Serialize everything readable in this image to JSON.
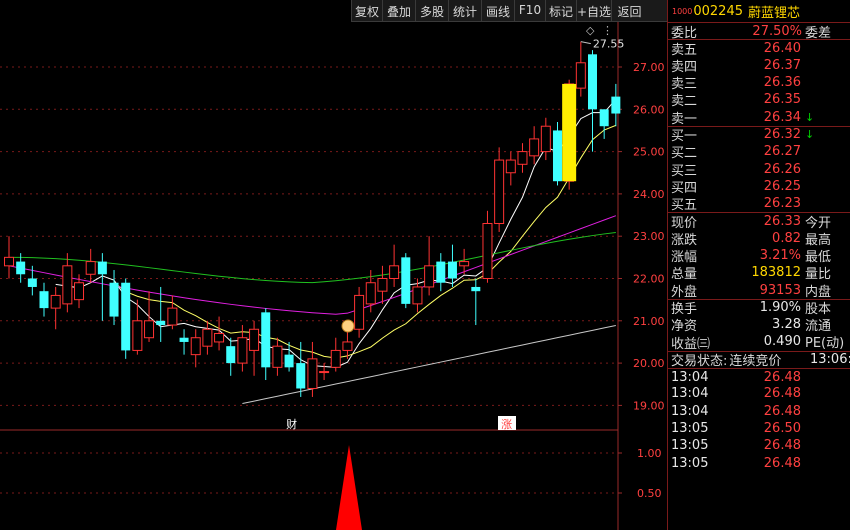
{
  "toolbar": {
    "buttons": [
      "复权",
      "叠加",
      "多股",
      "统计",
      "画线",
      "F10",
      "标记",
      "+自选",
      "返回"
    ]
  },
  "stock": {
    "prefix": "1000",
    "code": "002245",
    "name": "蔚蓝锂芯"
  },
  "quote": {
    "weibi_label": "委比",
    "weibi_value": "27.50%",
    "weicha_label": "委差",
    "sells": [
      {
        "label": "卖五",
        "price": "26.40"
      },
      {
        "label": "卖四",
        "price": "26.37"
      },
      {
        "label": "卖三",
        "price": "26.36"
      },
      {
        "label": "卖二",
        "price": "26.35"
      },
      {
        "label": "卖一",
        "price": "26.34",
        "arrow": "↓"
      }
    ],
    "buys": [
      {
        "label": "买一",
        "price": "26.32",
        "arrow": "↓"
      },
      {
        "label": "买二",
        "price": "26.27"
      },
      {
        "label": "买三",
        "price": "26.26"
      },
      {
        "label": "买四",
        "price": "26.25"
      },
      {
        "label": "买五",
        "price": "26.23"
      }
    ],
    "stats1": [
      {
        "label": "现价",
        "value": "26.33",
        "value_color": "red",
        "right": "今开"
      },
      {
        "label": "涨跌",
        "value": "0.82",
        "value_color": "red",
        "right": "最高"
      },
      {
        "label": "涨幅",
        "value": "3.21%",
        "value_color": "red",
        "right": "最低"
      },
      {
        "label": "总量",
        "value": "183812",
        "value_color": "yel",
        "right": "量比"
      },
      {
        "label": "外盘",
        "value": "93153",
        "value_color": "red",
        "right": "内盘"
      }
    ],
    "stats2": [
      {
        "label": "换手",
        "value": "1.90%",
        "value_color": "wht",
        "right": "股本"
      },
      {
        "label": "净资",
        "value": "3.28",
        "value_color": "wht",
        "right": "流通"
      },
      {
        "label": "收益㈢",
        "value": "0.490",
        "value_color": "wht",
        "right": "PE(动)"
      }
    ],
    "trade_status_label": "交易状态:",
    "trade_status": "连续竞价",
    "trade_time": "13:06:"
  },
  "ticks": [
    {
      "time": "13:04",
      "price": "26.48"
    },
    {
      "time": "13:04",
      "price": "26.48"
    },
    {
      "time": "13:04",
      "price": "26.48"
    },
    {
      "time": "13:05",
      "price": "26.50"
    },
    {
      "time": "13:05",
      "price": "26.48"
    },
    {
      "time": "13:05",
      "price": "26.48"
    }
  ],
  "chart_data": {
    "type": "candlestick",
    "price_axis": {
      "ticks": [
        "27.00",
        "26.00",
        "25.00",
        "24.00",
        "23.00",
        "22.00",
        "21.00",
        "20.00",
        "19.00"
      ],
      "range": [
        18.8,
        28.0
      ]
    },
    "max_label": "27.55",
    "markers": [
      {
        "text": "财",
        "color": "#ffffff",
        "index": 24
      },
      {
        "text": "涨",
        "color": "#ff4040",
        "index": 33
      }
    ],
    "candles": [
      {
        "o": 22.3,
        "c": 22.5,
        "h": 23.0,
        "l": 22.0
      },
      {
        "o": 22.4,
        "c": 22.1,
        "h": 22.6,
        "l": 21.9
      },
      {
        "o": 22.0,
        "c": 21.8,
        "h": 22.3,
        "l": 21.6
      },
      {
        "o": 21.7,
        "c": 21.3,
        "h": 21.9,
        "l": 21.1
      },
      {
        "o": 21.3,
        "c": 21.6,
        "h": 21.8,
        "l": 20.8
      },
      {
        "o": 21.4,
        "c": 22.3,
        "h": 22.6,
        "l": 21.2
      },
      {
        "o": 21.5,
        "c": 21.9,
        "h": 22.1,
        "l": 21.3
      },
      {
        "o": 22.1,
        "c": 22.4,
        "h": 22.7,
        "l": 21.9
      },
      {
        "o": 22.4,
        "c": 22.1,
        "h": 22.6,
        "l": 21.0
      },
      {
        "o": 21.9,
        "c": 21.1,
        "h": 22.2,
        "l": 20.9
      },
      {
        "o": 21.9,
        "c": 20.3,
        "h": 22.0,
        "l": 20.1
      },
      {
        "o": 20.3,
        "c": 21.0,
        "h": 21.5,
        "l": 20.2
      },
      {
        "o": 20.6,
        "c": 21.0,
        "h": 21.7,
        "l": 20.5
      },
      {
        "o": 21.0,
        "c": 20.9,
        "h": 21.8,
        "l": 20.5
      },
      {
        "o": 20.9,
        "c": 21.3,
        "h": 21.6,
        "l": 20.8
      },
      {
        "o": 20.6,
        "c": 20.5,
        "h": 20.8,
        "l": 20.2
      },
      {
        "o": 20.2,
        "c": 20.6,
        "h": 20.8,
        "l": 19.9
      },
      {
        "o": 20.4,
        "c": 20.8,
        "h": 21.0,
        "l": 20.2
      },
      {
        "o": 20.5,
        "c": 20.7,
        "h": 21.1,
        "l": 20.3
      },
      {
        "o": 20.4,
        "c": 20.0,
        "h": 20.6,
        "l": 19.7
      },
      {
        "o": 20.0,
        "c": 20.6,
        "h": 20.9,
        "l": 19.8
      },
      {
        "o": 20.3,
        "c": 20.8,
        "h": 21.0,
        "l": 19.7
      },
      {
        "o": 21.2,
        "c": 19.9,
        "h": 21.3,
        "l": 19.6
      },
      {
        "o": 19.9,
        "c": 20.4,
        "h": 20.6,
        "l": 19.7
      },
      {
        "o": 20.2,
        "c": 19.9,
        "h": 20.5,
        "l": 19.8
      },
      {
        "o": 20.0,
        "c": 19.4,
        "h": 20.5,
        "l": 19.2
      },
      {
        "o": 19.4,
        "c": 20.1,
        "h": 20.5,
        "l": 19.2
      },
      {
        "o": 19.8,
        "c": 19.8,
        "h": 20.0,
        "l": 19.6
      },
      {
        "o": 19.9,
        "c": 20.3,
        "h": 20.6,
        "l": 19.8
      },
      {
        "o": 20.3,
        "c": 20.5,
        "h": 20.8,
        "l": 20.1
      },
      {
        "o": 20.8,
        "c": 21.6,
        "h": 21.8,
        "l": 20.6
      },
      {
        "o": 21.4,
        "c": 21.9,
        "h": 22.2,
        "l": 21.2
      },
      {
        "o": 21.7,
        "c": 22.0,
        "h": 22.3,
        "l": 21.4
      },
      {
        "o": 22.0,
        "c": 22.3,
        "h": 22.8,
        "l": 21.8
      },
      {
        "o": 22.5,
        "c": 21.4,
        "h": 22.6,
        "l": 21.3
      },
      {
        "o": 21.4,
        "c": 21.8,
        "h": 22.0,
        "l": 21.2
      },
      {
        "o": 21.8,
        "c": 22.3,
        "h": 23.0,
        "l": 21.6
      },
      {
        "o": 22.4,
        "c": 21.9,
        "h": 22.6,
        "l": 21.7
      },
      {
        "o": 22.4,
        "c": 22.0,
        "h": 22.8,
        "l": 21.8
      },
      {
        "o": 22.3,
        "c": 22.4,
        "h": 22.7,
        "l": 22.1
      },
      {
        "o": 21.8,
        "c": 21.7,
        "h": 22.0,
        "l": 20.9
      },
      {
        "o": 22.0,
        "c": 23.3,
        "h": 23.6,
        "l": 21.9
      },
      {
        "o": 23.3,
        "c": 24.8,
        "h": 25.1,
        "l": 23.1
      },
      {
        "o": 24.5,
        "c": 24.8,
        "h": 25.0,
        "l": 24.2
      },
      {
        "o": 24.7,
        "c": 25.0,
        "h": 25.2,
        "l": 24.5
      },
      {
        "o": 24.9,
        "c": 25.3,
        "h": 25.6,
        "l": 24.7
      },
      {
        "o": 25.0,
        "c": 25.6,
        "h": 25.8,
        "l": 24.8
      },
      {
        "o": 25.5,
        "c": 24.3,
        "h": 25.7,
        "l": 24.2
      },
      {
        "o": 24.3,
        "c": 26.6,
        "h": 26.7,
        "l": 24.1
      },
      {
        "o": 26.5,
        "c": 27.1,
        "h": 27.6,
        "l": 26.3
      },
      {
        "o": 27.3,
        "c": 26.0,
        "h": 27.4,
        "l": 25.0
      },
      {
        "o": 26.0,
        "c": 25.6,
        "h": 26.0,
        "l": 25.3
      },
      {
        "o": 26.3,
        "c": 25.9,
        "h": 26.6,
        "l": 25.6
      }
    ],
    "volume_axis": {
      "ticks": [
        "1.00",
        "0.50"
      ]
    },
    "volume_peak_index": 24
  }
}
